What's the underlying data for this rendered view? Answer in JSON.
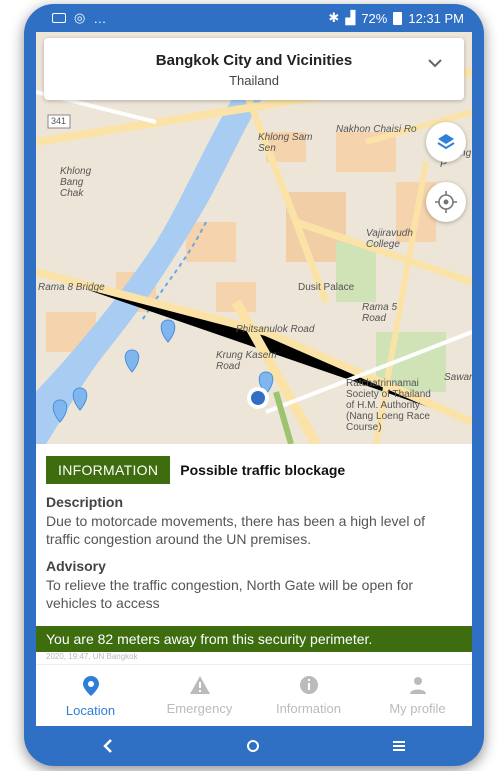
{
  "status_bar": {
    "left_text": "…",
    "battery": "72%",
    "time": "12:31 PM"
  },
  "location": {
    "title": "Bangkok City and Vicinities",
    "country": "Thailand"
  },
  "map_labels": {
    "road_marker": "341",
    "khlong_sam_sen": "Khlong Sam Sen",
    "nakhon_chaisi": "Nakhon Chaisi Ro",
    "khlong_bang_chak": "Khlong Bang Chak",
    "vajiravudh": "Vajiravudh College",
    "dusit_palace": "Dusit Palace",
    "rama5": "Rama 5 Road",
    "rama8": "Rama 8 Bridge",
    "phitsanulok": "Phitsanulok Road",
    "krung_kasem": "Krung Kasem Road",
    "ratchatrinnamai": "Ratchatrinnamai Society of Thailand of H.M. Authority (Nang Loeng Race Course)",
    "sawan": "Sawan",
    "khlong_p": "Khlong P"
  },
  "alert": {
    "badge": "INFORMATION",
    "headline": "Possible traffic blockage",
    "description_title": "Description",
    "description": "Due to motorcade movements, there has been a high level of traffic congestion around the UN premises.",
    "advisory_title": "Advisory",
    "advisory": "To relieve the traffic congestion, North Gate will be open for vehicles to access",
    "distance": "You are 82 meters away from this security perimeter.",
    "faded_text": "2020, 19:47, UN Bangkok"
  },
  "nav": {
    "items": [
      {
        "label": "Location",
        "icon": "location-pin-icon",
        "active": true
      },
      {
        "label": "Emergency",
        "icon": "warning-icon",
        "active": false
      },
      {
        "label": "Information",
        "icon": "info-icon",
        "active": false
      },
      {
        "label": "My profile",
        "icon": "person-icon",
        "active": false
      }
    ]
  },
  "colors": {
    "brand_blue": "#2f6fc4",
    "alert_green": "#3e6d10",
    "active_nav": "#2f7fd8"
  }
}
